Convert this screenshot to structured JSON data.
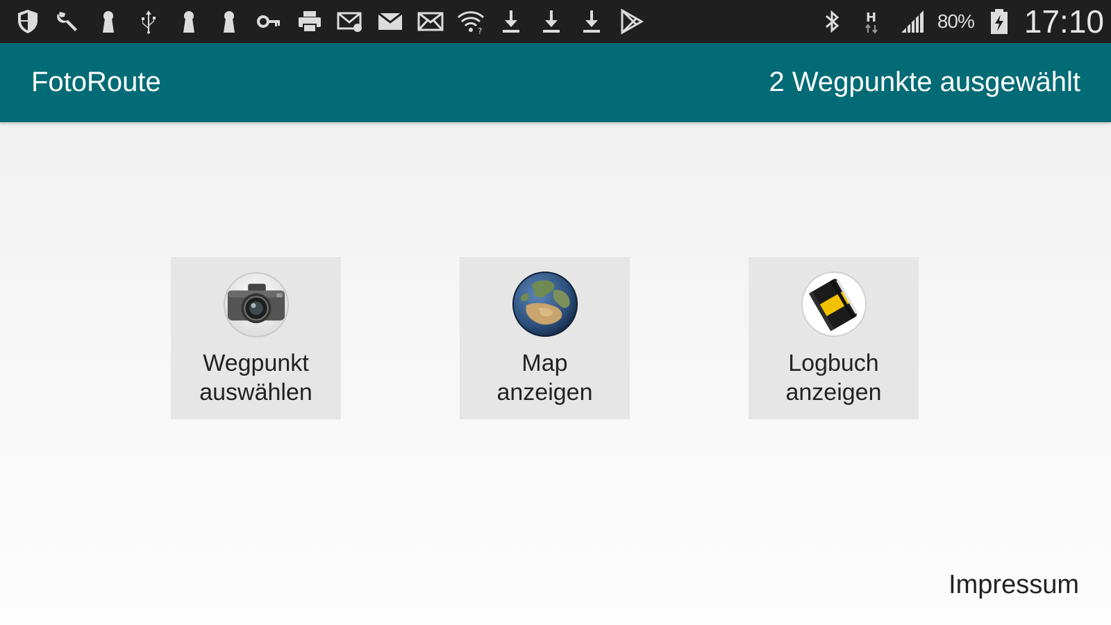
{
  "status_bar": {
    "left_icons": [
      "shield-icon",
      "wrench-icon",
      "keyhole-icon",
      "usb-icon",
      "keyhole-icon",
      "keyhole-icon",
      "key-icon",
      "printer-icon",
      "mail-sync-icon",
      "mail-icon",
      "mail-open-icon",
      "wifi-question-icon",
      "download-icon",
      "download-icon",
      "download-icon",
      "play-store-icon"
    ],
    "right_icons": [
      "bluetooth-icon",
      "h-network-icon",
      "signal-icon",
      "battery-charging-icon"
    ],
    "battery_percent": "80%",
    "time": "17:10"
  },
  "action_bar": {
    "title": "FotoRoute",
    "selection_status": "2 Wegpunkte ausgewählt",
    "background_color": "#036b75"
  },
  "tiles": [
    {
      "label": "Wegpunkt\nauswählen",
      "icon": "camera-icon"
    },
    {
      "label": "Map\nanzeigen",
      "icon": "globe-icon"
    },
    {
      "label": "Logbuch\nanzeigen",
      "icon": "notebook-icon"
    }
  ],
  "footer": {
    "impressum_label": "Impressum"
  }
}
